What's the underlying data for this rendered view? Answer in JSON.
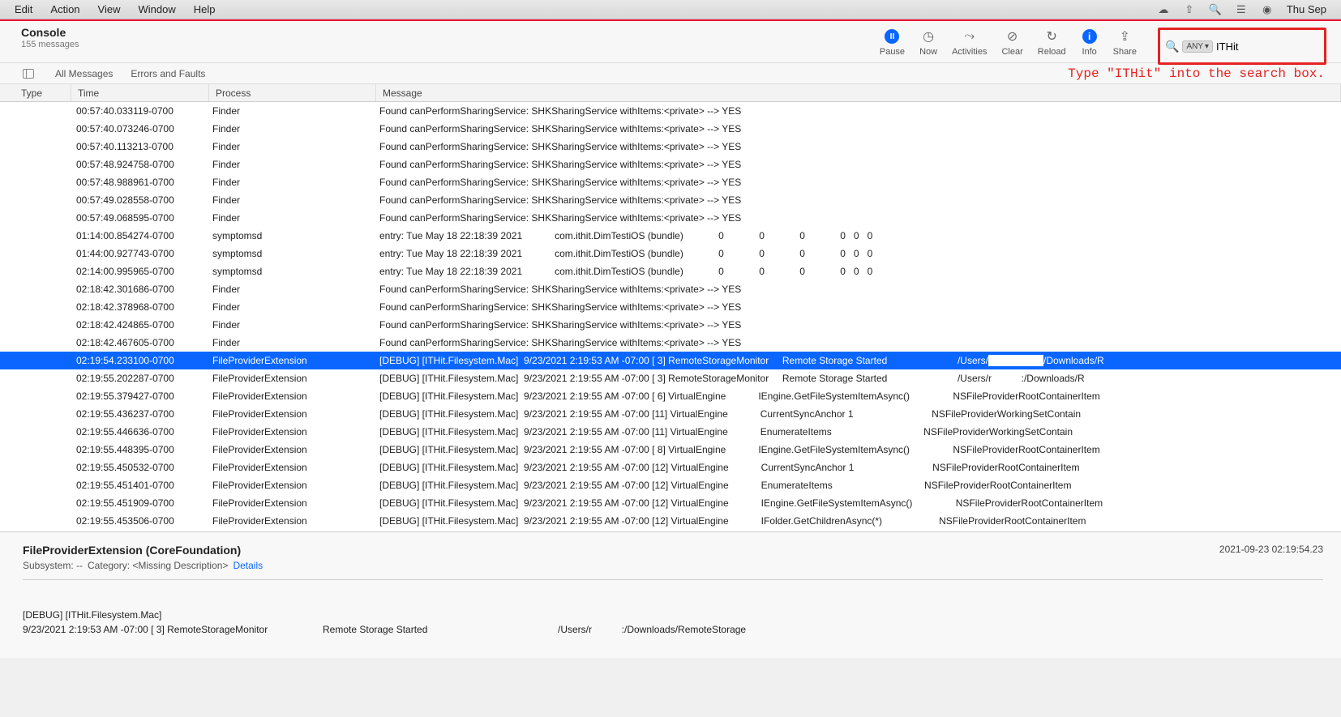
{
  "menubar": {
    "items": [
      "Edit",
      "Action",
      "View",
      "Window",
      "Help"
    ],
    "date": "Thu Sep"
  },
  "header": {
    "title": "Console",
    "count": "155 messages"
  },
  "toolbar": {
    "pause": "Pause",
    "now": "Now",
    "activities": "Activities",
    "clear": "Clear",
    "reload": "Reload",
    "info": "Info",
    "share": "Share"
  },
  "search": {
    "any": "ANY",
    "value": "ITHit"
  },
  "filter": {
    "all": "All Messages",
    "errors": "Errors and Faults"
  },
  "columns": {
    "type": "Type",
    "time": "Time",
    "process": "Process",
    "message": "Message"
  },
  "rows": [
    {
      "time": "00:57:40.033119-0700",
      "proc": "Finder",
      "msg": "Found canPerformSharingService: SHKSharingService withItems:<private> --> YES"
    },
    {
      "time": "00:57:40.073246-0700",
      "proc": "Finder",
      "msg": "Found canPerformSharingService: SHKSharingService withItems:<private> --> YES"
    },
    {
      "time": "00:57:40.113213-0700",
      "proc": "Finder",
      "msg": "Found canPerformSharingService: SHKSharingService withItems:<private> --> YES"
    },
    {
      "time": "00:57:48.924758-0700",
      "proc": "Finder",
      "msg": "Found canPerformSharingService: SHKSharingService withItems:<private> --> YES"
    },
    {
      "time": "00:57:48.988961-0700",
      "proc": "Finder",
      "msg": "Found canPerformSharingService: SHKSharingService withItems:<private> --> YES"
    },
    {
      "time": "00:57:49.028558-0700",
      "proc": "Finder",
      "msg": "Found canPerformSharingService: SHKSharingService withItems:<private> --> YES"
    },
    {
      "time": "00:57:49.068595-0700",
      "proc": "Finder",
      "msg": "Found canPerformSharingService: SHKSharingService withItems:<private> --> YES"
    },
    {
      "time": "01:14:00.854274-0700",
      "proc": "symptomsd",
      "msg": "entry: Tue May 18 22:18:39 2021            com.ithit.DimTestiOS (bundle)             0             0             0             0   0   0"
    },
    {
      "time": "01:44:00.927743-0700",
      "proc": "symptomsd",
      "msg": "entry: Tue May 18 22:18:39 2021            com.ithit.DimTestiOS (bundle)             0             0             0             0   0   0"
    },
    {
      "time": "02:14:00.995965-0700",
      "proc": "symptomsd",
      "msg": "entry: Tue May 18 22:18:39 2021            com.ithit.DimTestiOS (bundle)             0             0             0             0   0   0"
    },
    {
      "time": "02:18:42.301686-0700",
      "proc": "Finder",
      "msg": "Found canPerformSharingService: SHKSharingService withItems:<private> --> YES"
    },
    {
      "time": "02:18:42.378968-0700",
      "proc": "Finder",
      "msg": "Found canPerformSharingService: SHKSharingService withItems:<private> --> YES"
    },
    {
      "time": "02:18:42.424865-0700",
      "proc": "Finder",
      "msg": "Found canPerformSharingService: SHKSharingService withItems:<private> --> YES"
    },
    {
      "time": "02:18:42.467605-0700",
      "proc": "Finder",
      "msg": "Found canPerformSharingService: SHKSharingService withItems:<private> --> YES"
    },
    {
      "time": "02:19:54.233100-0700",
      "proc": "FileProviderExtension",
      "msg": "[DEBUG] [ITHit.Filesystem.Mac]  9/23/2021 2:19:53 AM -07:00 [ 3] RemoteStorageMonitor     Remote Storage Started                          /Users/████████/Downloads/R",
      "sel": true
    },
    {
      "time": "02:19:55.202287-0700",
      "proc": "FileProviderExtension",
      "msg": "[DEBUG] [ITHit.Filesystem.Mac]  9/23/2021 2:19:55 AM -07:00 [ 3] RemoteStorageMonitor     Remote Storage Started                          /Users/r           :/Downloads/R"
    },
    {
      "time": "02:19:55.379427-0700",
      "proc": "FileProviderExtension",
      "msg": "[DEBUG] [ITHit.Filesystem.Mac]  9/23/2021 2:19:55 AM -07:00 [ 6] VirtualEngine            IEngine.GetFileSystemItemAsync()                NSFileProviderRootContainerItem"
    },
    {
      "time": "02:19:55.436237-0700",
      "proc": "FileProviderExtension",
      "msg": "[DEBUG] [ITHit.Filesystem.Mac]  9/23/2021 2:19:55 AM -07:00 [11] VirtualEngine            CurrentSyncAnchor 1                             NSFileProviderWorkingSetContain"
    },
    {
      "time": "02:19:55.446636-0700",
      "proc": "FileProviderExtension",
      "msg": "[DEBUG] [ITHit.Filesystem.Mac]  9/23/2021 2:19:55 AM -07:00 [11] VirtualEngine            EnumerateItems                                  NSFileProviderWorkingSetContain"
    },
    {
      "time": "02:19:55.448395-0700",
      "proc": "FileProviderExtension",
      "msg": "[DEBUG] [ITHit.Filesystem.Mac]  9/23/2021 2:19:55 AM -07:00 [ 8] VirtualEngine            IEngine.GetFileSystemItemAsync()                NSFileProviderRootContainerItem"
    },
    {
      "time": "02:19:55.450532-0700",
      "proc": "FileProviderExtension",
      "msg": "[DEBUG] [ITHit.Filesystem.Mac]  9/23/2021 2:19:55 AM -07:00 [12] VirtualEngine            CurrentSyncAnchor 1                             NSFileProviderRootContainerItem"
    },
    {
      "time": "02:19:55.451401-0700",
      "proc": "FileProviderExtension",
      "msg": "[DEBUG] [ITHit.Filesystem.Mac]  9/23/2021 2:19:55 AM -07:00 [12] VirtualEngine            EnumerateItems                                  NSFileProviderRootContainerItem"
    },
    {
      "time": "02:19:55.451909-0700",
      "proc": "FileProviderExtension",
      "msg": "[DEBUG] [ITHit.Filesystem.Mac]  9/23/2021 2:19:55 AM -07:00 [12] VirtualEngine            IEngine.GetFileSystemItemAsync()                NSFileProviderRootContainerItem"
    },
    {
      "time": "02:19:55.453506-0700",
      "proc": "FileProviderExtension",
      "msg": "[DEBUG] [ITHit.Filesystem.Mac]  9/23/2021 2:19:55 AM -07:00 [12] VirtualEngine            IFolder.GetChildrenAsync(*)                     NSFileProviderRootContainerItem"
    }
  ],
  "detail": {
    "title": "FileProviderExtension (CoreFoundation)",
    "subsystem": "Subsystem: --",
    "category": "Category:  <Missing Description>",
    "details_link": "Details",
    "timestamp": "2021-09-23 02:19:54.23",
    "body_line1": "[DEBUG] [ITHit.Filesystem.Mac]",
    "body_line2a": "9/23/2021 2:19:53 AM -07:00 [ 3] RemoteStorageMonitor",
    "body_line2b": "Remote Storage Started",
    "body_line2c": "/Users/r           :/Downloads/RemoteStorage"
  },
  "annotation": "Type \"ITHit\" into the search box."
}
